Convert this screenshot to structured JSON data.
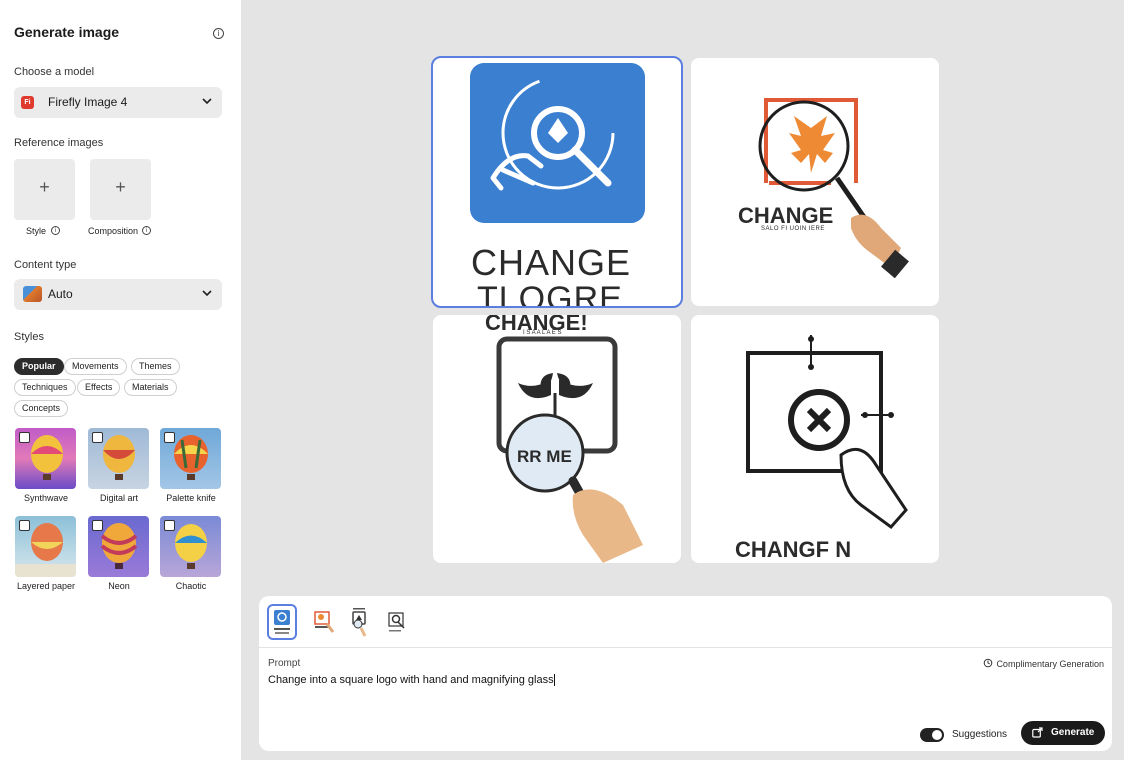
{
  "sidebar": {
    "title": "Generate image",
    "model_label": "Choose a model",
    "model_value": "Firefly Image 4",
    "model_logo": "Fi",
    "reference_label": "Reference images",
    "ref_style": "Style",
    "ref_composition": "Composition",
    "content_type_label": "Content type",
    "content_type_value": "Auto",
    "styles_label": "Styles",
    "style_tabs": [
      "Popular",
      "Movements",
      "Themes",
      "Techniques",
      "Effects",
      "Materials",
      "Concepts"
    ],
    "style_presets": [
      "Synthwave",
      "Digital art",
      "Palette knife",
      "Layered paper",
      "Neon",
      "Chaotic"
    ]
  },
  "images": {
    "img1_text_a": "CHANGE",
    "img1_text_b": "TLOGRE",
    "img2_text_a": "CHANGE",
    "img2_text_b": "SALO FI UOIN IERE",
    "img3_text_a": "CHANGE!",
    "img3_text_b": "I S A A L A E S",
    "img3_text_c": "RR ME",
    "img4_text_a": "CHANGF N"
  },
  "prompt": {
    "label": "Prompt",
    "text": "Change into a square logo with hand and magnifying glass",
    "complimentary": "Complimentary Generation",
    "suggestions_label": "Suggestions",
    "generate_label": "Generate"
  },
  "icons": {
    "info": "info-icon",
    "chevron": "chevron-down-icon",
    "add": "plus-icon",
    "generate": "generate-icon"
  },
  "colors": {
    "accent_blue": "#5a7fe0",
    "logo_blue": "#3a7fd0",
    "firefly_red": "#e03a2f",
    "dark_button": "#1b1b1b"
  }
}
